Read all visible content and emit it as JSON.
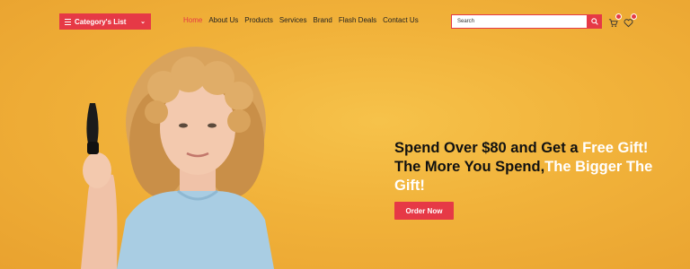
{
  "header": {
    "category_label": "Category's List",
    "menu": [
      {
        "label": "Home",
        "active": true
      },
      {
        "label": "About Us"
      },
      {
        "label": "Products"
      },
      {
        "label": "Services"
      },
      {
        "label": "Brand"
      },
      {
        "label": "Flash Deals"
      },
      {
        "label": "Contact Us"
      }
    ],
    "search_placeholder": "Search"
  },
  "hero": {
    "line1_prefix": "Spend Over $80 and Get a ",
    "line1_highlight": "Free Gift!",
    "line2_prefix": "The More You Spend,",
    "line2_highlight": "The Bigger The Gift!",
    "cta_label": "Order Now"
  },
  "colors": {
    "accent": "#e63946",
    "background": "#f1b23a"
  }
}
